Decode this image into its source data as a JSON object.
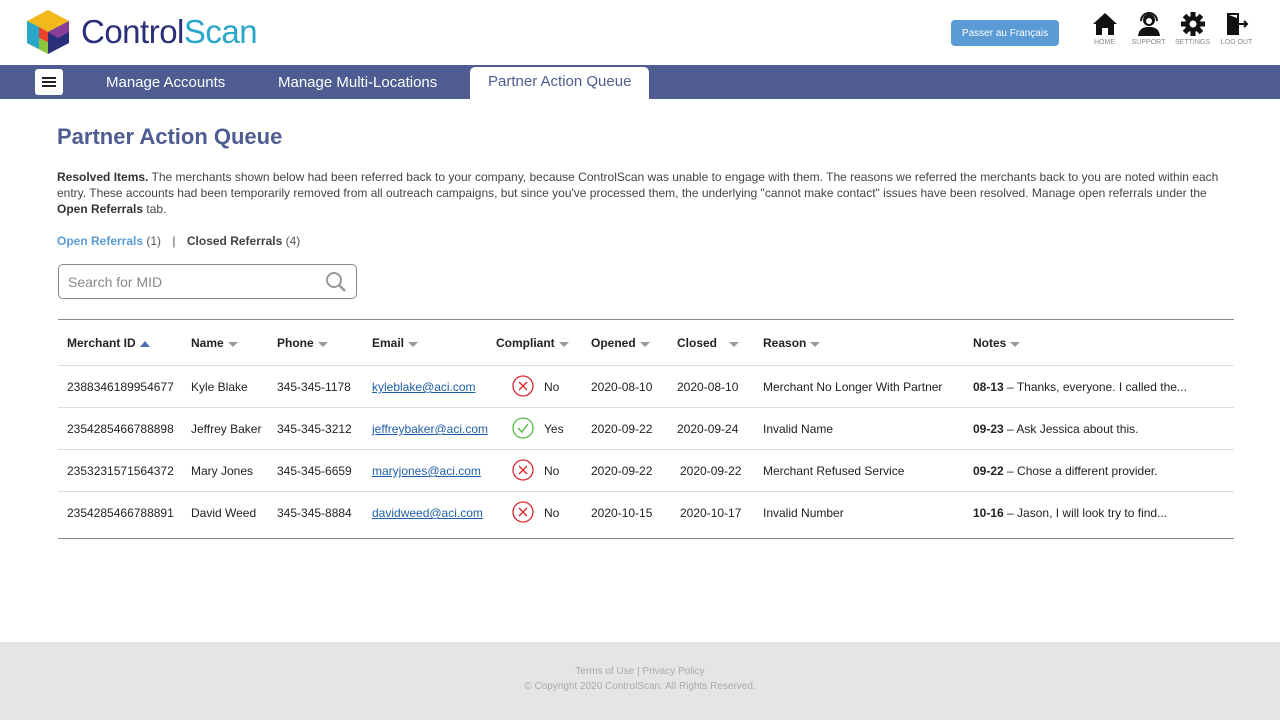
{
  "brand": {
    "name_part1": "Control",
    "name_part2": "Scan",
    "colors": {
      "primary": "#2a2f7a",
      "secondary": "#2aa6c8",
      "nav": "#4e5c91",
      "accent": "#5b9bd5"
    }
  },
  "header": {
    "lang_button": "Passer au Français",
    "icons": [
      {
        "icon": "home-icon",
        "label": "HOME"
      },
      {
        "icon": "support-icon",
        "label": "SUPPORT"
      },
      {
        "icon": "gear-icon",
        "label": "SETTINGS"
      },
      {
        "icon": "logout-icon",
        "label": "LOG OUT"
      }
    ]
  },
  "nav": {
    "tabs": [
      {
        "label": "Manage Accounts",
        "active": false
      },
      {
        "label": "Manage Multi-Locations",
        "active": false
      },
      {
        "label": "Partner Action Queue",
        "active": true
      }
    ]
  },
  "main": {
    "title": "Partner Action Queue",
    "desc_bold": "Resolved Items.",
    "desc_text1": " The merchants shown below had been referred back to your company, because ControlScan was unable to engage with them.  The reasons we referred the merchants back to you are noted within each entry. These accounts had been temporarily removed from all outreach campaigns, but since you've processed them, the underlying \"cannot make contact\" issues have been resolved. Manage open referrals under the ",
    "desc_bold2": "Open Referrals",
    "desc_text2": " tab.",
    "filters": {
      "open_label": "Open Referrals",
      "open_count": "(1)",
      "separator": "|",
      "closed_label": "Closed Referrals",
      "closed_count": "(4)"
    },
    "search": {
      "placeholder": "Search for MID",
      "value": ""
    }
  },
  "table": {
    "columns": [
      "Merchant ID",
      "Name",
      "Phone",
      "Email",
      "Compliant",
      "Opened",
      "Closed",
      "Reason",
      "Notes"
    ],
    "sorted_column": "Merchant ID",
    "rows": [
      {
        "mid": "2388346189954677",
        "name": "Kyle Blake",
        "phone": "345-345-1178",
        "email": "kyleblake@aci.com",
        "compliant": "No",
        "opened": "2020-08-10",
        "closed": "2020-08-10",
        "reason": "Merchant No Longer With Partner",
        "note_date": "08-13",
        "note_text": " – Thanks, everyone.  I called the..."
      },
      {
        "mid": "2354285466788898",
        "name": "Jeffrey Baker",
        "phone": "345-345-3212",
        "email": "jeffreybaker@aci.com",
        "compliant": "Yes",
        "opened": "2020-09-22",
        "closed": "2020-09-24",
        "reason": "Invalid Name",
        "note_date": "09-23",
        "note_text": " – Ask Jessica about this."
      },
      {
        "mid": "2353231571564372",
        "name": "Mary Jones",
        "phone": "345-345-6659",
        "email": "maryjones@aci.com",
        "compliant": "No",
        "opened": "2020-09-22",
        "closed": "2020-09-22",
        "reason": "Merchant Refused Service",
        "note_date": "09-22",
        "note_text": " – Chose a different provider."
      },
      {
        "mid": "2354285466788891",
        "name": "David Weed",
        "phone": "345-345-8884",
        "email": "davidweed@aci.com",
        "compliant": "No",
        "opened": "2020-10-15",
        "closed": "2020-10-17",
        "reason": "Invalid Number",
        "note_date": "10-16",
        "note_text": " – Jason, I will look try to find..."
      }
    ]
  },
  "footer": {
    "terms": "Terms of Use",
    "sep": " | ",
    "privacy": "Privacy Policy",
    "copyright": "© Copyright 2020 ControlScan. All Rights Reserved."
  }
}
